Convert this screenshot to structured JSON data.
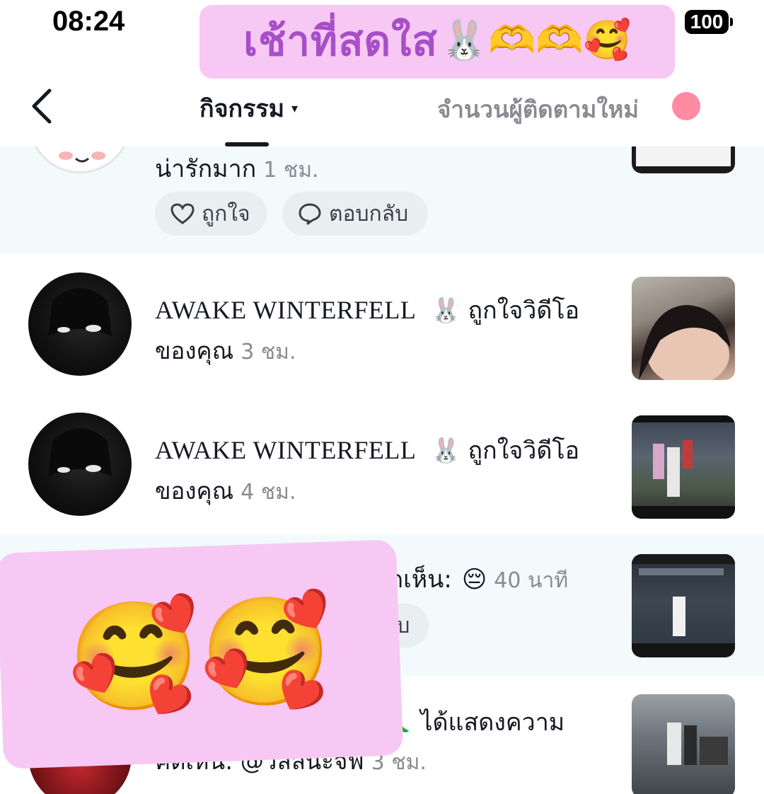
{
  "status_bar": {
    "time": "08:24",
    "battery": "100"
  },
  "banner": {
    "text": "เช้าที่สดใส",
    "emoji": "🐰🫶🫶🥰"
  },
  "nav": {
    "tab_activity": "กิจกรรม",
    "tab_activity_caret": "▾",
    "tab_followers": "จำนวนผู้ติดตามใหม่"
  },
  "rows": [
    {
      "line1": "น่ารักมาก",
      "time": "1 ชม.",
      "like_label": "ถูกใจ",
      "reply_label": "ตอบกลับ"
    },
    {
      "username": "AWAKE WINTERFELL",
      "emoji": "🐰",
      "action": "ถูกใจวิดีโอ",
      "line2": "ของคุณ",
      "time": "3 ชม."
    },
    {
      "username": "AWAKE WINTERFELL",
      "emoji": "🐰",
      "action": "ถูกใจวิดีโอ",
      "line2": "ของคุณ",
      "time": "4 ชม."
    },
    {
      "line1": "ดเห็น:",
      "emoji": "😔",
      "time": "40 นาที",
      "reply_partial": "ลับ"
    },
    {
      "line1": "ได้แสดงความ",
      "line2": "คิดเห็น: @วิลลีนะจีฟ",
      "time": "3 ชม.",
      "emoji": "🦜"
    }
  ],
  "overlay2": {
    "emoji": "🥰🥰"
  }
}
